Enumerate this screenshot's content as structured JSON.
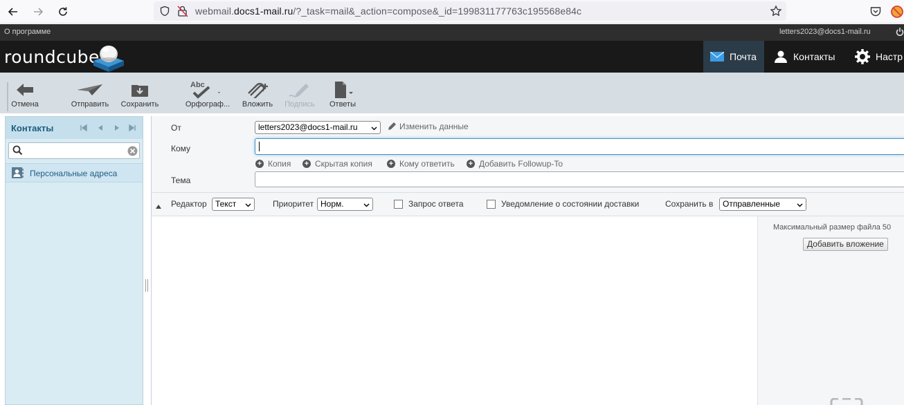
{
  "browser": {
    "url_prefix": "webmail.",
    "url_domain": "docs1-mail.ru",
    "url_rest": "/?_task=mail&_action=compose&_id=199831177763c195568e84c"
  },
  "topline": {
    "about": "О программе",
    "user": "letters2023@docs1-mail.ru"
  },
  "header": {
    "logo": "roundcube",
    "nav": [
      {
        "label": "Почта"
      },
      {
        "label": "Контакты"
      },
      {
        "label": "Настр"
      }
    ]
  },
  "toolbar": {
    "cancel": "Отмена",
    "send": "Отправить",
    "save": "Сохранить",
    "spell": "Орфограф...",
    "attach": "Вложить",
    "signature": "Подпись",
    "responses": "Ответы"
  },
  "contacts": {
    "title": "Контакты",
    "search_value": "",
    "items": [
      {
        "label": "Персональные адреса"
      }
    ]
  },
  "compose": {
    "from_label": "От",
    "from_value": "letters2023@docs1-mail.ru",
    "edit_identity": "Изменить данные",
    "to_label": "Кому",
    "to_value": "",
    "add_links": {
      "cc": "Копия",
      "bcc": "Скрытая копия",
      "reply_to": "Кому ответить",
      "followup": "Добавить Followup-To"
    },
    "subject_label": "Тема",
    "subject_value": "",
    "options": {
      "editor_label": "Редактор",
      "editor_value": "Текст",
      "priority_label": "Приоритет",
      "priority_value": "Норм.",
      "mdn": "Запрос ответа",
      "dsn": "Уведомление о состоянии доставки",
      "save_in_label": "Сохранить в",
      "save_in_value": "Отправленные"
    },
    "attachments": {
      "max_size": "Максимальный размер файла 50",
      "add_button": "Добавить вложение"
    }
  },
  "colors": {
    "header_bg": "#191919",
    "active_nav": "#2c3b48",
    "toolbar_bg": "#d6dde3",
    "panel_bg": "#d9ecf4",
    "accent_blue": "#1e5d80",
    "logo_blue": "#2d83c4"
  }
}
